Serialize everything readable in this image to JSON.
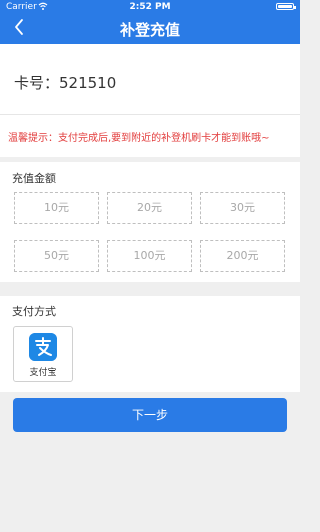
{
  "status_bar": {
    "carrier": "Carrier",
    "time": "2:52 PM"
  },
  "nav": {
    "title": "补登充值",
    "back_icon": "chevron-left-icon"
  },
  "card": {
    "label": "卡号：521510"
  },
  "tip": {
    "text": "温馨提示：支付完成后,要到附近的补登机刷卡才能到账哦~"
  },
  "amount": {
    "heading": "充值金额",
    "options": [
      "10元",
      "20元",
      "30元",
      "50元",
      "100元",
      "200元"
    ]
  },
  "payment": {
    "heading": "支付方式",
    "methods": [
      {
        "name": "支付宝",
        "icon": "alipay-icon",
        "color": "#1e88e5"
      }
    ]
  },
  "actions": {
    "next_label": "下一步"
  },
  "colors": {
    "primary": "#2a7be6",
    "warning_text": "#e23b3b"
  }
}
